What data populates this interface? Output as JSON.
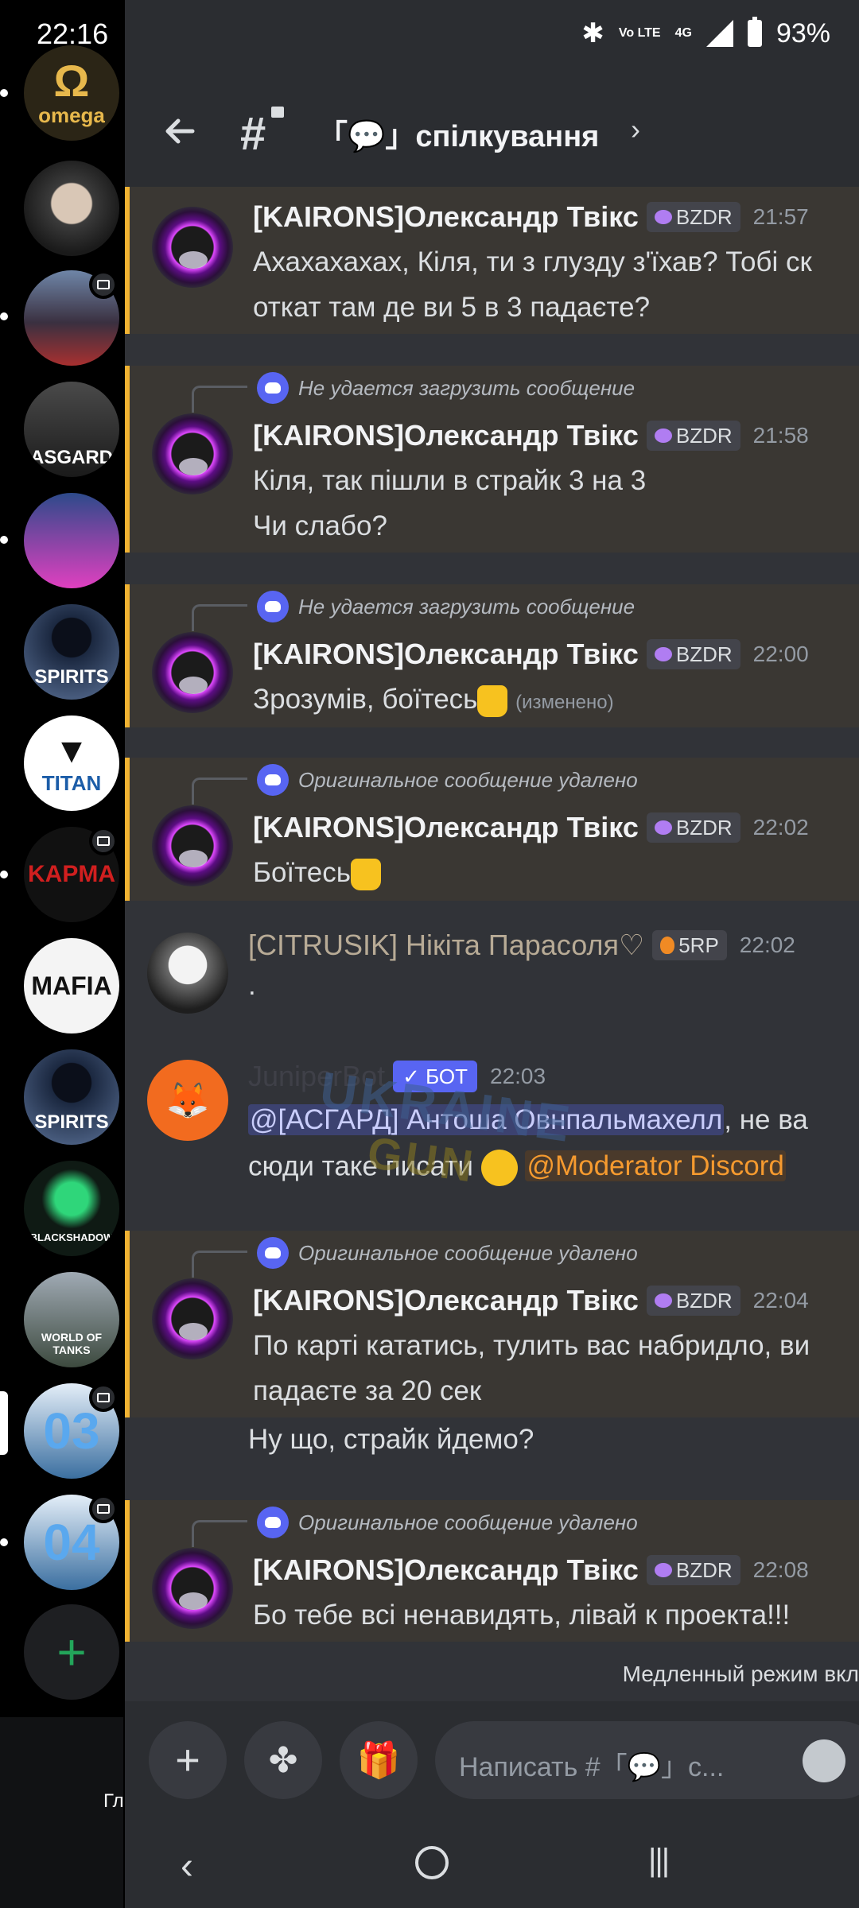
{
  "status_bar": {
    "time": "22:16",
    "network_lte": "Vo LTE",
    "network_gen": "4G",
    "battery": "93%"
  },
  "servers": [
    {
      "name": "omega",
      "label": "omega",
      "color": "#2b2516"
    },
    {
      "name": "server-face",
      "label": "",
      "color": "#2a2a2a"
    },
    {
      "name": "server-city",
      "label": "",
      "color": "#3a3040"
    },
    {
      "name": "server-asgard",
      "label": "ASGARD",
      "color": "#2a2a2a"
    },
    {
      "name": "server-bezdelnik",
      "label": "",
      "color": "#5a2a6a"
    },
    {
      "name": "server-spirits-1",
      "label": "SPIRITS",
      "color": "#1b2840"
    },
    {
      "name": "server-titan",
      "label": "TITAN",
      "color": "#ffffff"
    },
    {
      "name": "server-karma",
      "label": "KAPMA",
      "color": "#111111"
    },
    {
      "name": "server-mafia",
      "label": "MAFIA",
      "color": "#ffffff"
    },
    {
      "name": "server-spirits-2",
      "label": "SPIRITS",
      "color": "#1b2840"
    },
    {
      "name": "server-blackshadow",
      "label": "BLACKSHADOW",
      "color": "#0f1a14"
    },
    {
      "name": "server-worldoftanks",
      "label": "WORLD OF TANKS",
      "color": "#3d4a3f"
    },
    {
      "name": "server-03",
      "label": "03",
      "color": "#3b6fa0"
    },
    {
      "name": "server-04",
      "label": "04",
      "color": "#3b6fa0"
    }
  ],
  "bottom_left_text": "Гл",
  "channel": {
    "name": "「💬」спілкування",
    "chevron": "›"
  },
  "messages": [
    {
      "author": "[KAIRONS]Олександр Твікс",
      "tag": "BZDR",
      "time": "21:57",
      "lines": [
        "Ахахахахах, Кіля, ти з глузду з'їхав? Тобі ск",
        "откат там де ви 5 в 3 падаєте?"
      ]
    },
    {
      "reply": "Не удается загрузить сообщение",
      "author": "[KAIRONS]Олександр Твікс",
      "tag": "BZDR",
      "time": "21:58",
      "lines": [
        "Кіля, так пішли в страйк 3 на 3",
        "Чи слабо?"
      ]
    },
    {
      "reply": "Не удается загрузить сообщение",
      "author": "[KAIRONS]Олександр Твікс",
      "tag": "BZDR",
      "time": "22:00",
      "lines": [
        "Зрозумів, боїтесь"
      ],
      "edited": "(изменено)"
    },
    {
      "reply": "Оригинальное сообщение удалено",
      "author": "[KAIRONS]Олександр Твікс",
      "tag": "BZDR",
      "time": "22:02",
      "lines": [
        "Боїтесь"
      ]
    },
    {
      "author": "[CITRUSIK] Нікіта Парасоля♡",
      "tag": "5RP",
      "time": "22:02",
      "lines": [
        "."
      ]
    },
    {
      "author": "JuniperBot",
      "tag": "✓ БОТ",
      "time": "22:03",
      "mention1": "@[АСГАРД] Антоша Овнпальмахелл",
      "line1_rest": ", не ва",
      "line2_start": "сюди таке писати",
      "mention2": "@Moderator Discord"
    },
    {
      "reply": "Оригинальное сообщение удалено",
      "author": "[KAIRONS]Олександр Твікс",
      "tag": "BZDR",
      "time": "22:04",
      "lines": [
        "По карті кататись, тулить вас набридло, ви",
        "падаєте за 20 сек",
        "Ну що, страйк йдемо?"
      ]
    },
    {
      "reply": "Оригинальное сообщение удалено",
      "author": "[KAIRONS]Олександр Твікс",
      "tag": "BZDR",
      "time": "22:08",
      "lines": [
        "Бо тебе всі ненавидять, лівай к проекта!!!"
      ]
    }
  ],
  "watermark": {
    "line1": "UKRAINE",
    "line2": "GUN"
  },
  "slowmode": "Медленный режим вкл",
  "composer": {
    "placeholder": "Написать #「💬」с..."
  },
  "colors": {
    "accent": "#5865f2",
    "highlight_border": "#f0b232",
    "add_server": "#23a55a"
  }
}
